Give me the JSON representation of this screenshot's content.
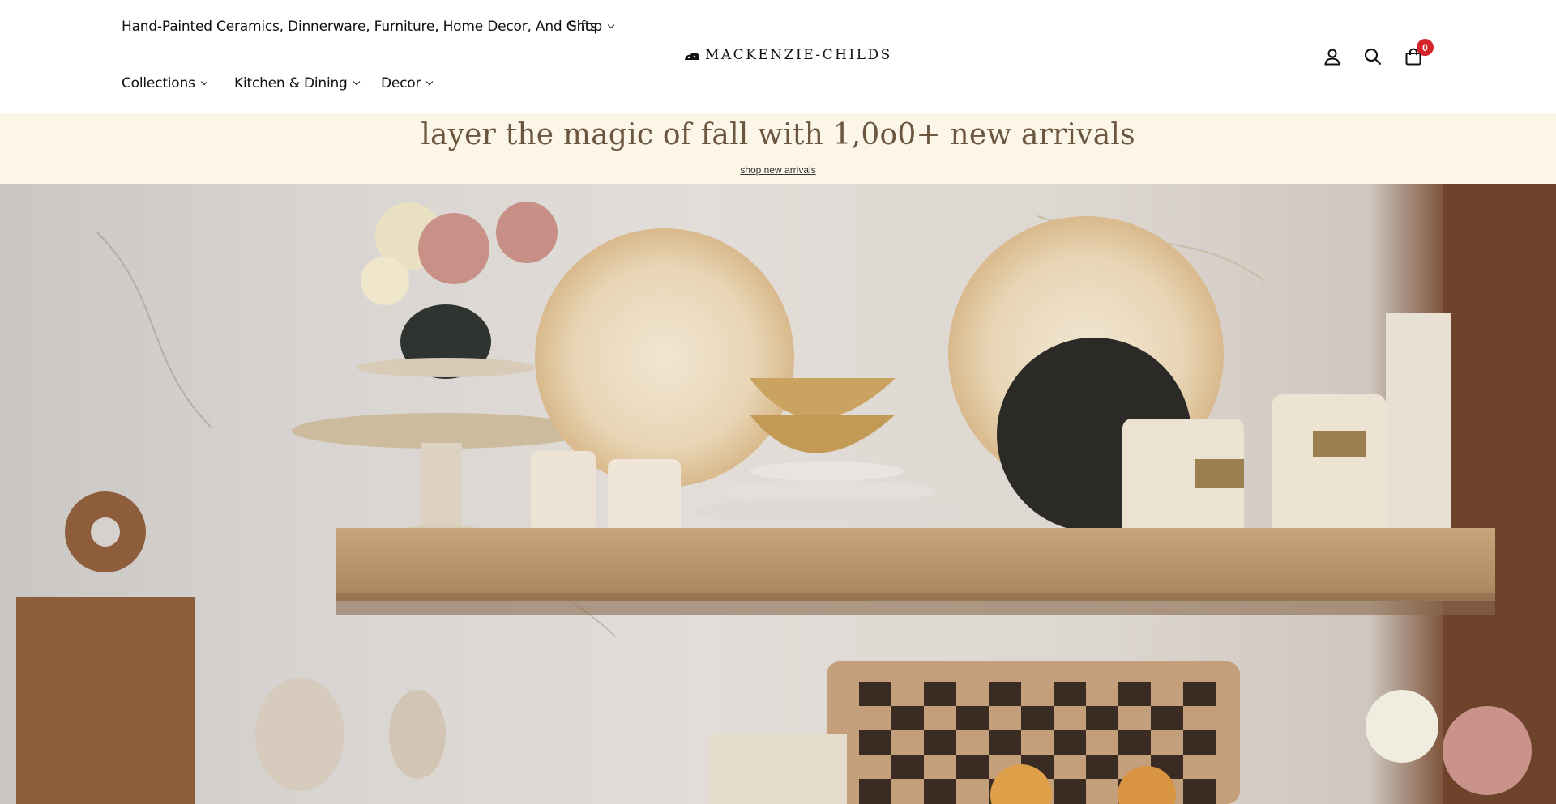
{
  "header": {
    "tagline": "Hand-Painted Ceramics, Dinnerware, Furniture, Home Decor, And Gifts",
    "nav": {
      "shop": "Shop",
      "collections": "Collections",
      "kitchen_dining": "Kitchen & Dining",
      "decor": "Decor"
    },
    "logo_text": "MACKENZIE-CHILDS",
    "icons": [
      "account-icon",
      "search-icon",
      "cart-icon"
    ],
    "cart_count": "0"
  },
  "promo": {
    "title": "layer the magic of fall with 1,0o0+ new arrivals",
    "link": "shop new arrivals"
  },
  "hero": {
    "image": "kitchen shelf with floral ceramics, cake stand, bowls, plates, canisters, cutting boards"
  },
  "colors": {
    "promo_bg": "#fcf6e8",
    "promo_text": "#6b5640",
    "badge": "#d2262c"
  }
}
